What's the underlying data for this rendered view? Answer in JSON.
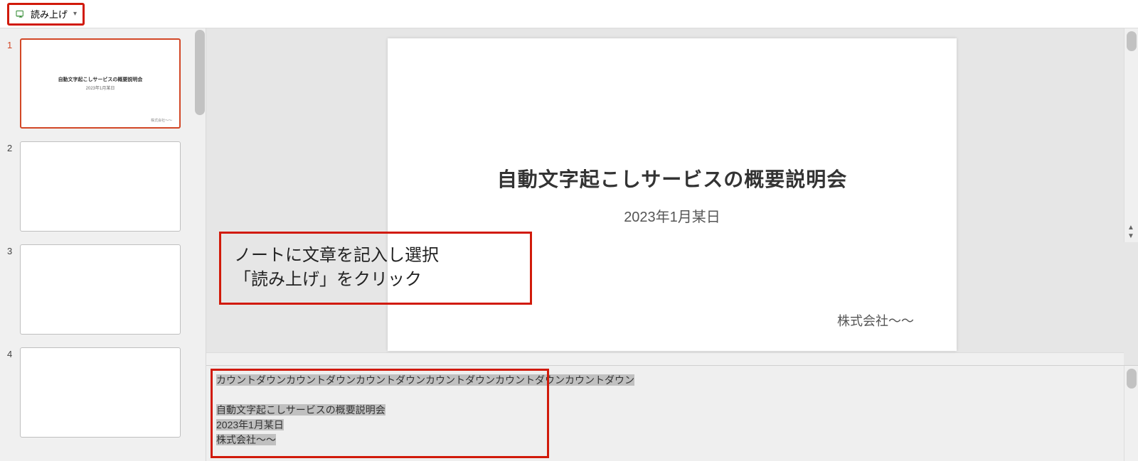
{
  "toolbar": {
    "read_aloud_label": "読み上げ"
  },
  "thumbnails": {
    "items": [
      {
        "num": "1",
        "title": "自動文字起こしサービスの概要説明会",
        "date": "2023年1月某日",
        "corp": "株式会社～～"
      },
      {
        "num": "2"
      },
      {
        "num": "3"
      },
      {
        "num": "4"
      }
    ]
  },
  "slide": {
    "title": "自動文字起こしサービスの概要説明会",
    "date": "2023年1月某日",
    "corp": "株式会社～～"
  },
  "annotation": {
    "line1": "ノートに文章を記入し選択",
    "line2": "「読み上げ」をクリック"
  },
  "notes": {
    "line1": "カウントダウンカウントダウンカウントダウンカウントダウンカウントダウンカウントダウン",
    "line2": "自動文字起こしサービスの概要説明会",
    "line3": "2023年1月某日",
    "line4": "株式会社～～"
  }
}
